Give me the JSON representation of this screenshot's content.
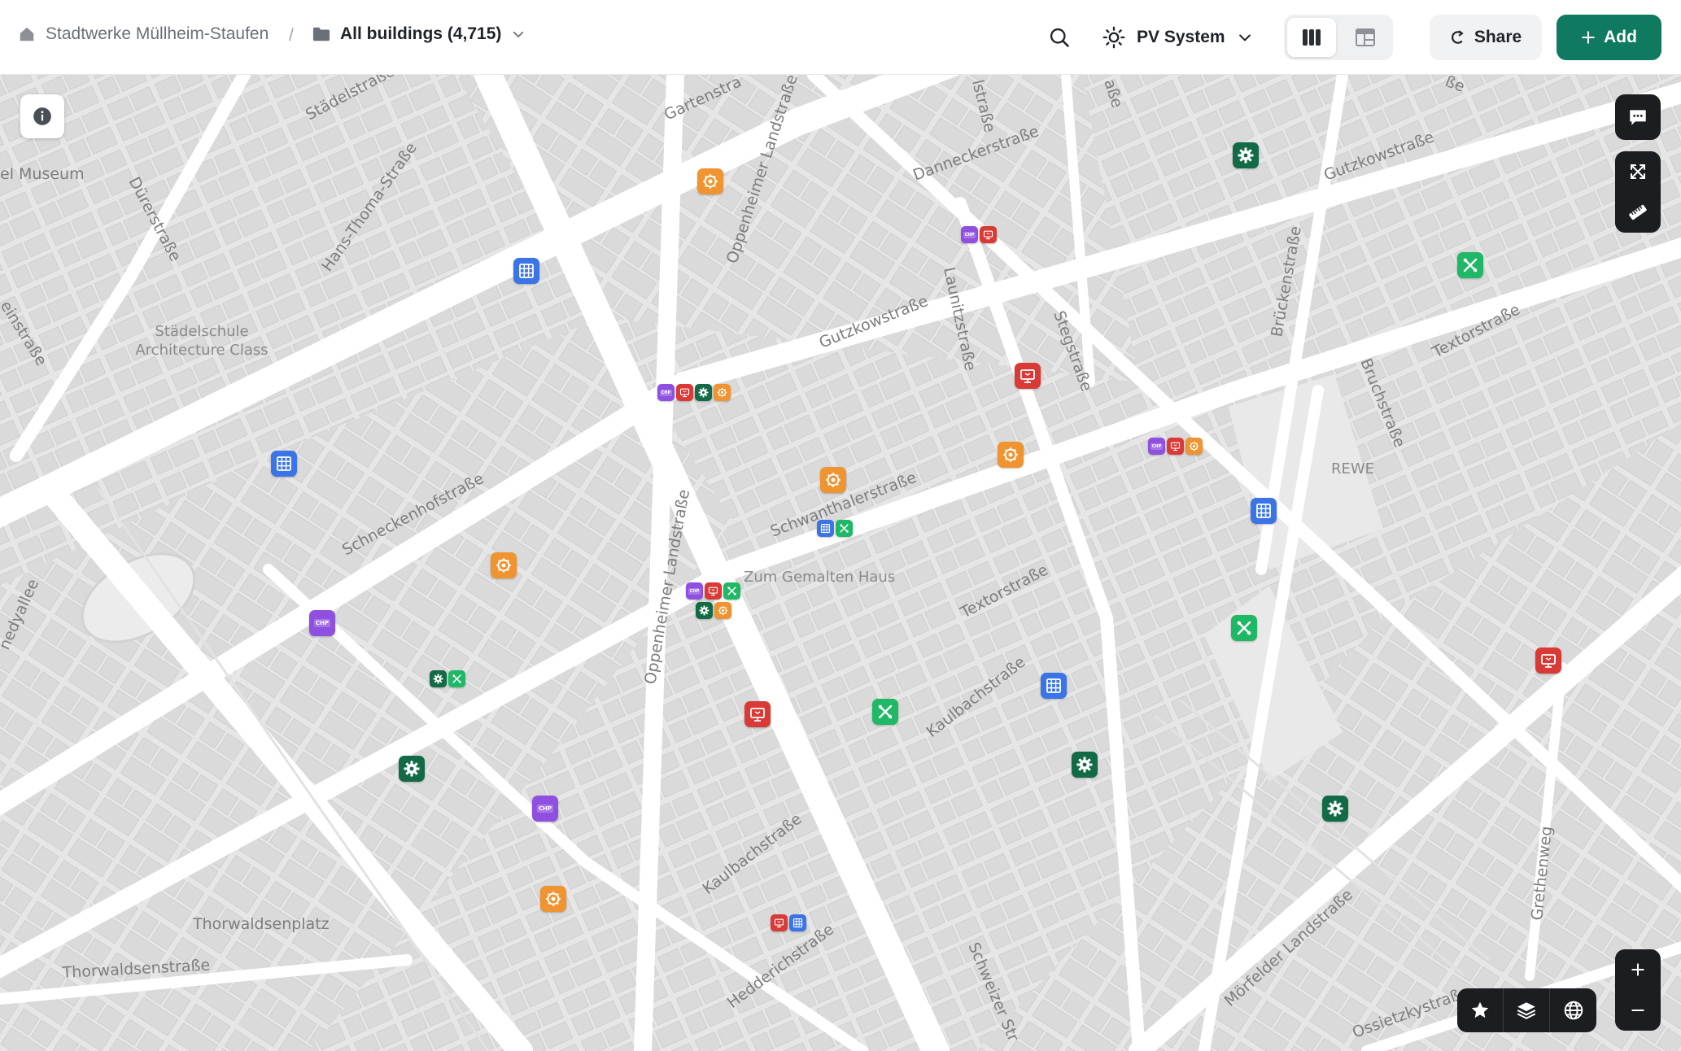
{
  "header": {
    "org_name": "Stadtwerke Müllheim-Staufen",
    "separator": "/",
    "folder_label": "All buildings (4,715)",
    "layer_label": "PV System",
    "share_label": "Share",
    "add_label": "Add"
  },
  "map": {
    "streets": {
      "staedelstrasse": "Städelstraße",
      "gartenstrasse": "Gartenstra",
      "oppenheimer_top": "Oppenheimer Landstraße",
      "lstrasse": "lstraße",
      "asse": "aße",
      "ne_corner": "ße",
      "museum": "el Museum",
      "duererstrasse": "Dürerstraße",
      "hans_thoma": "Hans-Thoma-Straße",
      "dannecker": "Danneckerstraße",
      "gutzkow_ne": "Gutzkowstraße",
      "einstrasse": "einstraße",
      "gutzkow_mid": "Gutzkowstraße",
      "launitz": "Launitzstraße",
      "steg": "Stegstraße",
      "brueckenstrasse": "Brückenstraße",
      "textor_ne": "Textorstraße",
      "bruchstrasse": "Bruchstraße",
      "schwanthaler": "Schwanthalerstraße",
      "schneckenhof": "Schneckenhofstraße",
      "oppenheimer_mid": "Oppenheimer Landstraße",
      "textor_mid": "Textorstraße",
      "kaulbach_mid": "Kaulbachstraße",
      "nedyallee": "nedyallee",
      "kaulbach_low": "Kaulbachstraße",
      "heddrich": "Hedderichstraße",
      "thorwaldsen_platz": "Thorwaldsenplatz",
      "thorwaldsen_str": "Thorwaldsenstraße",
      "schweizer": "Schweizer Str",
      "moerfelder": "Mörfelder Landstraße",
      "grethenweg": "Grethenweg",
      "ossietzky": "Ossietzkystraß"
    },
    "pois": {
      "staedelschule_line1": "Städelschule",
      "staedelschule_line2": "Architecture Class",
      "zum_gemalten_haus": "Zum Gemalten Haus",
      "rewe": "REWE"
    },
    "marker_chp_text": "CHP"
  },
  "colors": {
    "accent": "#0f7a5f",
    "solar_thermal": "#ef9431",
    "pv": "#3b74e6",
    "chp": "#8f4fe0",
    "heat_pump_display": "#d93a35",
    "gear": "#126b46",
    "tools": "#1fb866"
  }
}
